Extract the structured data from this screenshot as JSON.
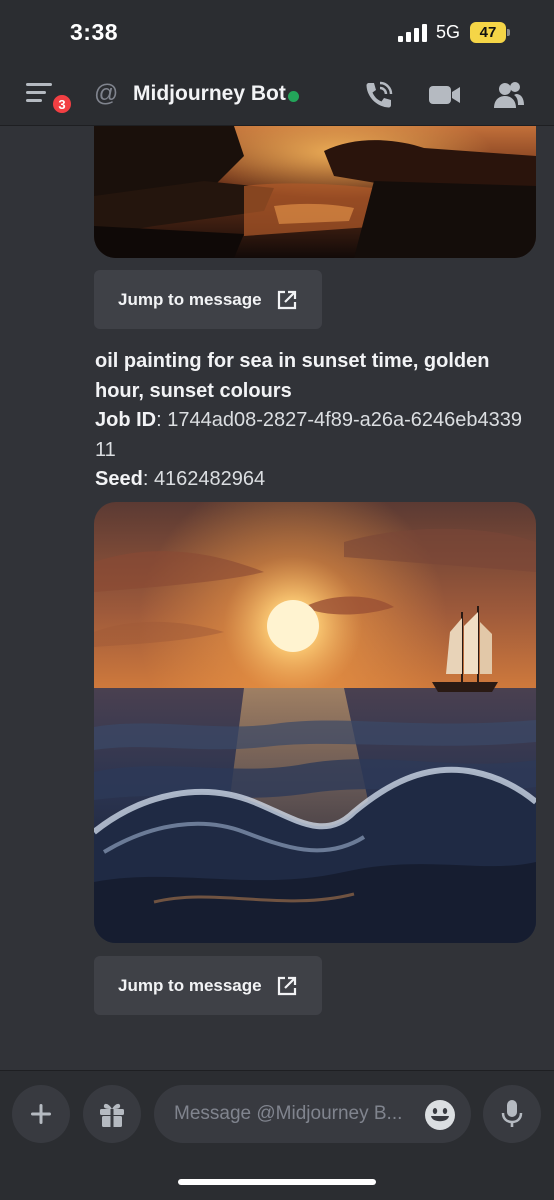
{
  "status_bar": {
    "time": "3:38",
    "network": "5G",
    "battery": "47"
  },
  "header": {
    "unread_count": "3",
    "channel_name": "Midjourney Bot",
    "icons": [
      "menu-icon",
      "at-icon",
      "phone-call-icon",
      "video-camera-icon",
      "members-icon"
    ],
    "online_color": "#23a55a"
  },
  "messages": {
    "jump_label": "Jump to message",
    "prompt": "oil painting for sea in sunset time, golden hour, sunset colours",
    "job_id_label": "Job ID",
    "job_id": "1744ad08-2827-4f89-a26a-6246eb433911",
    "seed_label": "Seed",
    "seed": "4162482964"
  },
  "composer": {
    "placeholder": "Message @Midjourney B...",
    "icons": [
      "plus-icon",
      "gift-icon",
      "emoji-icon",
      "microphone-icon"
    ]
  },
  "colors": {
    "background": "#313338",
    "header": "#2b2d31",
    "button": "#3f4147",
    "badge": "#f23f43",
    "battery": "#f5d547"
  }
}
